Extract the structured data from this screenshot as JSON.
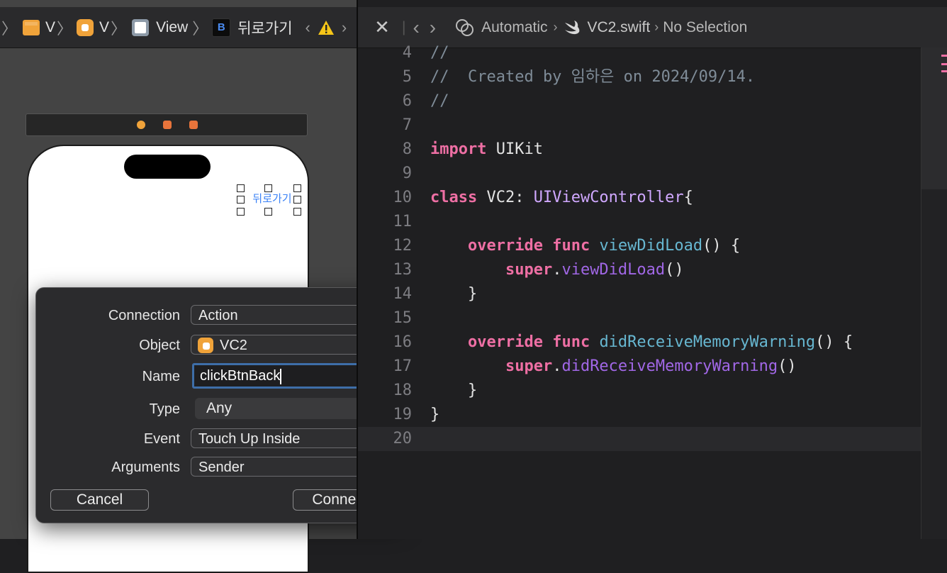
{
  "left_jumpbar": {
    "items": [
      "V",
      "V",
      "View",
      "뒤로가기"
    ]
  },
  "right_jumpbar": {
    "crumbs": [
      "Automatic",
      "VC2.swift",
      "No Selection"
    ]
  },
  "canvas": {
    "button_title": "뒤로가기"
  },
  "popover": {
    "connection_label": "Connection",
    "connection_value": "Action",
    "object_label": "Object",
    "object_value": "VC2",
    "name_label": "Name",
    "name_value": "clickBtnBack",
    "type_label": "Type",
    "type_value": "Any",
    "event_label": "Event",
    "event_value": "Touch Up Inside",
    "arguments_label": "Arguments",
    "arguments_value": "Sender",
    "cancel_label": "Cancel",
    "connect_label": "Connect"
  },
  "code": {
    "lines": [
      {
        "n": "4",
        "t": "//"
      },
      {
        "n": "5",
        "t": "//  Created by 임하은 on 2024/09/14."
      },
      {
        "n": "6",
        "t": "//"
      },
      {
        "n": "7",
        "t": ""
      },
      {
        "n": "8",
        "t": "import UIKit"
      },
      {
        "n": "9",
        "t": ""
      },
      {
        "n": "10",
        "t": "class VC2: UIViewController{"
      },
      {
        "n": "11",
        "t": ""
      },
      {
        "n": "12",
        "t": "    override func viewDidLoad() {"
      },
      {
        "n": "13",
        "t": "        super.viewDidLoad()"
      },
      {
        "n": "14",
        "t": "    }"
      },
      {
        "n": "15",
        "t": ""
      },
      {
        "n": "16",
        "t": "    override func didReceiveMemoryWarning() {"
      },
      {
        "n": "17",
        "t": "        super.didReceiveMemoryWarning()"
      },
      {
        "n": "18",
        "t": "    }"
      },
      {
        "n": "19",
        "t": "}"
      },
      {
        "n": "20",
        "t": ""
      }
    ]
  }
}
